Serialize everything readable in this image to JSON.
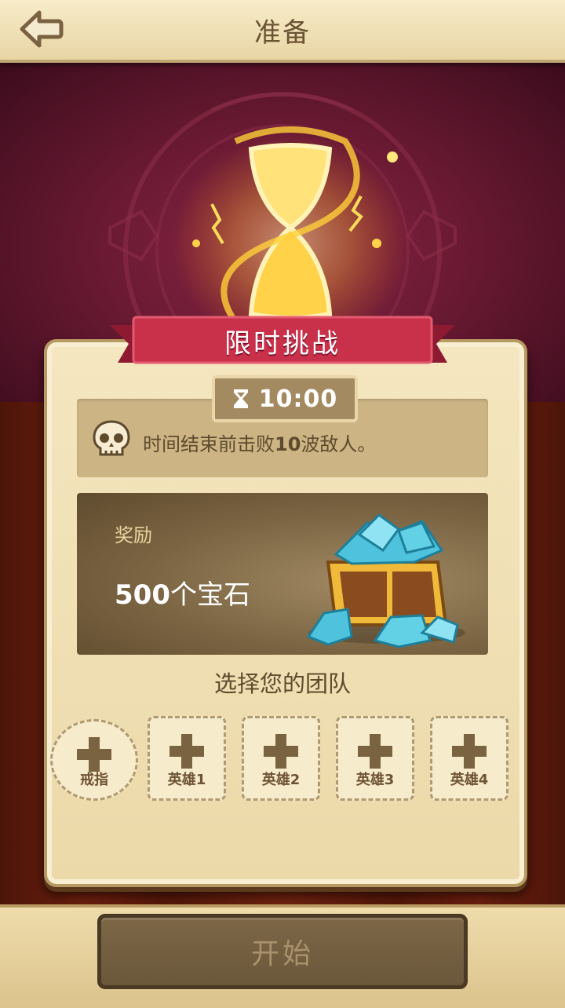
{
  "header": {
    "title": "准备",
    "back_icon": "back-arrow-icon"
  },
  "challenge": {
    "banner": "限时挑战",
    "timer": "10:00",
    "timer_icon": "hourglass-icon"
  },
  "objective": {
    "prefix": "时间结束前击败",
    "count": "10",
    "suffix": "波敌人。",
    "icon": "skull-icon"
  },
  "reward": {
    "label": "奖励",
    "amount": "500",
    "unit": "个宝石"
  },
  "team": {
    "title": "选择您的团队",
    "slots": [
      {
        "label": "戒指"
      },
      {
        "label": "英雄1"
      },
      {
        "label": "英雄2"
      },
      {
        "label": "英雄3"
      },
      {
        "label": "英雄4"
      }
    ]
  },
  "footer": {
    "start_label": "开始"
  },
  "colors": {
    "accent": "#c9304a",
    "panel": "#f4e6bf",
    "hero_bg": "#6a1a33"
  }
}
